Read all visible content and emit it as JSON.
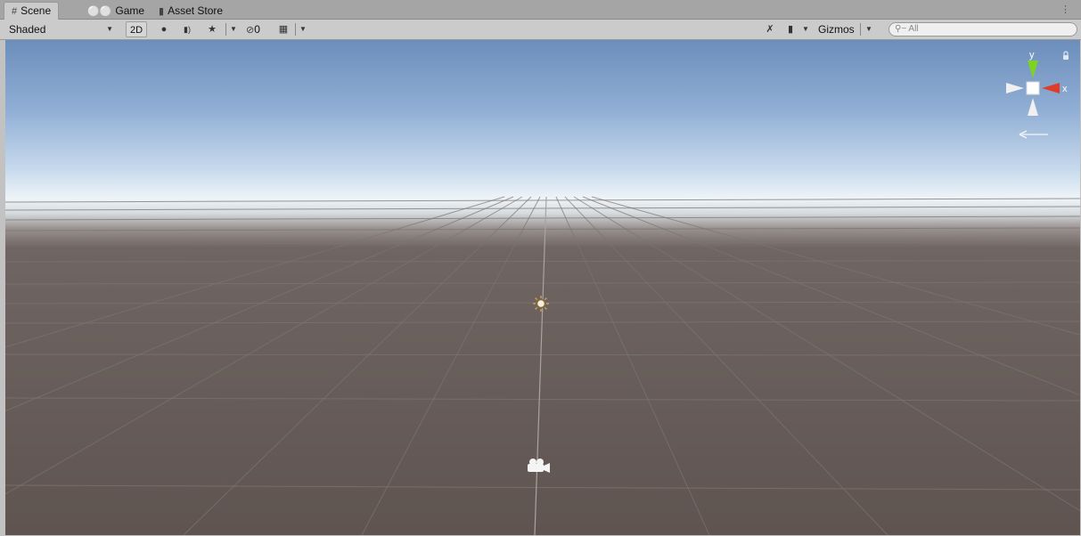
{
  "tabs": [
    {
      "label": "Scene",
      "icon": "hash-icon"
    },
    {
      "label": "Game",
      "icon": "gamepad-icon"
    },
    {
      "label": "Asset Store",
      "icon": "shopping-bag-icon"
    }
  ],
  "toolbar": {
    "draw_mode": "Shaded",
    "btn_2d": "2D",
    "hidden_count": "0",
    "gizmos_label": "Gizmos",
    "search_placeholder": "All"
  },
  "orientation_gizmo": {
    "y_label": "y",
    "x_label": "x",
    "y_color": "#7ed321",
    "x_color": "#e03c2a"
  }
}
